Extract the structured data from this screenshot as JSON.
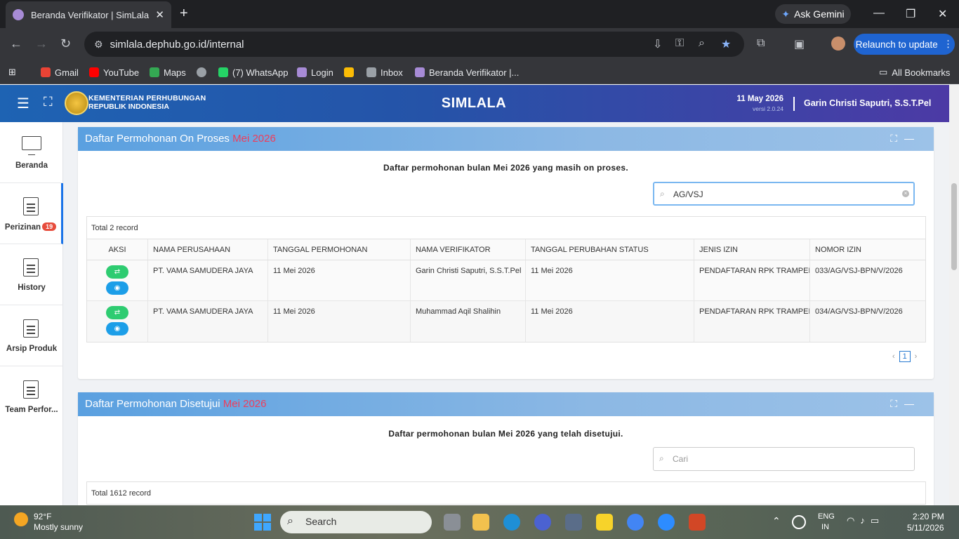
{
  "browser": {
    "tab_title": "Beranda Verifikator | SimLala",
    "url": "simlala.dephub.go.id/internal",
    "ask_gemini": "Ask Gemini",
    "relaunch": "Relaunch to update",
    "bookmarks": [
      {
        "label": "Gmail",
        "color": "#ea4335"
      },
      {
        "label": "YouTube",
        "color": "#ff0000"
      },
      {
        "label": "Maps",
        "color": "#34a853"
      },
      {
        "label": "",
        "color": "#9aa0a6"
      },
      {
        "label": "(7) WhatsApp",
        "color": "#25d366"
      },
      {
        "label": "Login",
        "color": "#a78bd6"
      },
      {
        "label": "",
        "color": "#fbbc05"
      },
      {
        "label": "Inbox",
        "color": "#9aa0a6"
      },
      {
        "label": "Beranda Verifikator |...",
        "color": "#a78bd6"
      }
    ],
    "all_bookmarks": "All Bookmarks"
  },
  "header": {
    "org_line1": "KEMENTERIAN PERHUBUNGAN",
    "org_line2": "REPUBLIK INDONESIA",
    "title": "SIMLALA",
    "date": "11 May 2026",
    "version": "versi 2.0.24",
    "user": "Garin Christi Saputri, S.S.T.Pel"
  },
  "sidebar": {
    "items": [
      {
        "label": "Beranda"
      },
      {
        "label": "Perizinan",
        "badge": "19"
      },
      {
        "label": "History"
      },
      {
        "label": "Arsip Produk"
      },
      {
        "label": "Team Perfor..."
      }
    ]
  },
  "card1": {
    "title": "Daftar Permohonan On Proses ",
    "title_month": "Mei 2026",
    "subtitle": "Daftar permohonan bulan Mei 2026 yang masih on proses.",
    "search_value": "AG/VSJ",
    "total": "Total 2 record",
    "columns": [
      "AKSI",
      "NAMA PERUSAHAAN",
      "TANGGAL PERMOHONAN",
      "NAMA VERIFIKATOR",
      "TANGGAL PERUBAHAN STATUS",
      "JENIS IZIN",
      "NOMOR IZIN"
    ],
    "rows": [
      [
        "",
        "PT. VAMA SAMUDERA JAYA",
        "11 Mei 2026",
        "Garin Christi Saputri, S.S.T.Pel",
        "11 Mei 2026",
        "PENDAFTARAN RPK TRAMPER",
        "033/AG/VSJ-BPN/V/2026"
      ],
      [
        "",
        "PT. VAMA SAMUDERA JAYA",
        "11 Mei 2026",
        "Muhammad Aqil Shalihin",
        "11 Mei 2026",
        "PENDAFTARAN RPK TRAMPER",
        "034/AG/VSJ-BPN/V/2026"
      ]
    ],
    "page": "1"
  },
  "card2": {
    "title": "Daftar Permohonan Disetujui ",
    "title_month": "Mei 2026",
    "subtitle": "Daftar permohonan bulan Mei 2026 yang telah disetujui.",
    "search_placeholder": "Cari",
    "total": "Total 1612 record"
  },
  "taskbar": {
    "temp": "92°F",
    "weather": "Mostly sunny",
    "search": "Search",
    "lang1": "ENG",
    "lang2": "IN",
    "time": "2:20 PM",
    "date": "5/11/2026"
  },
  "colors": {
    "accent": "#1a73e8",
    "month_red": "#ef3d5b",
    "btn_green": "#2ecc71",
    "btn_blue": "#1c9ee8"
  }
}
